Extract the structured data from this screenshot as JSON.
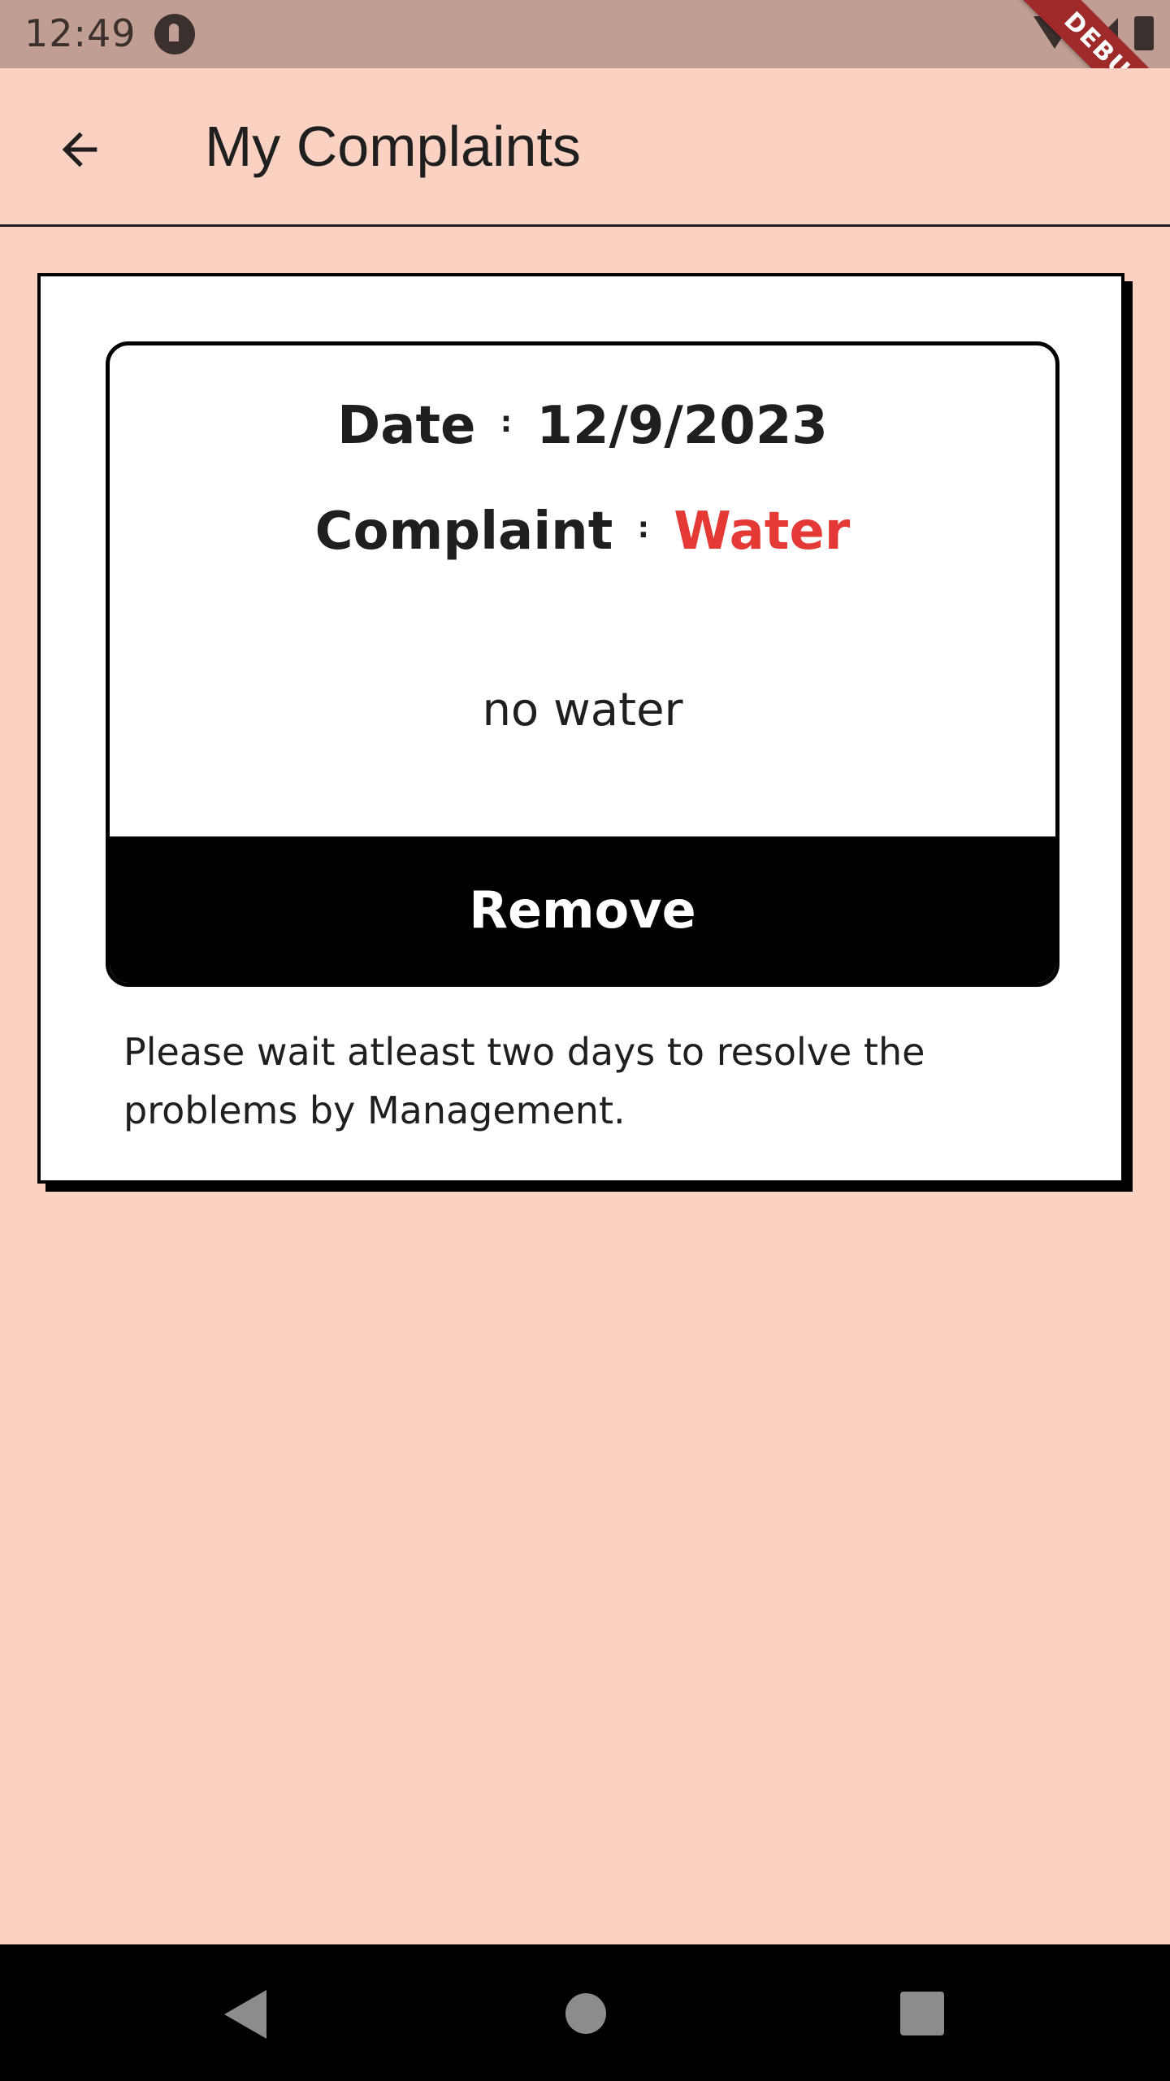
{
  "status_bar": {
    "time": "12:49",
    "debug_banner": "DEBUG"
  },
  "app_bar": {
    "title": "My Complaints",
    "back_icon": "arrow-back-icon"
  },
  "complaint": {
    "date_label": "Date",
    "date_value": "12/9/2023",
    "separator": ":",
    "complaint_label": "Complaint",
    "complaint_value": "Water",
    "description": "no water",
    "remove_label": "Remove"
  },
  "notice": "Please wait atleast two days to resolve the problems by Management.",
  "colors": {
    "background": "#fbd1c1",
    "status_bar": "#c09e93",
    "complaint_type": "#e53935",
    "debug_ribbon": "#9e2a2a"
  },
  "nav_bar": {
    "back_icon": "triangle-back-icon",
    "home_icon": "circle-home-icon",
    "recents_icon": "square-recents-icon"
  }
}
